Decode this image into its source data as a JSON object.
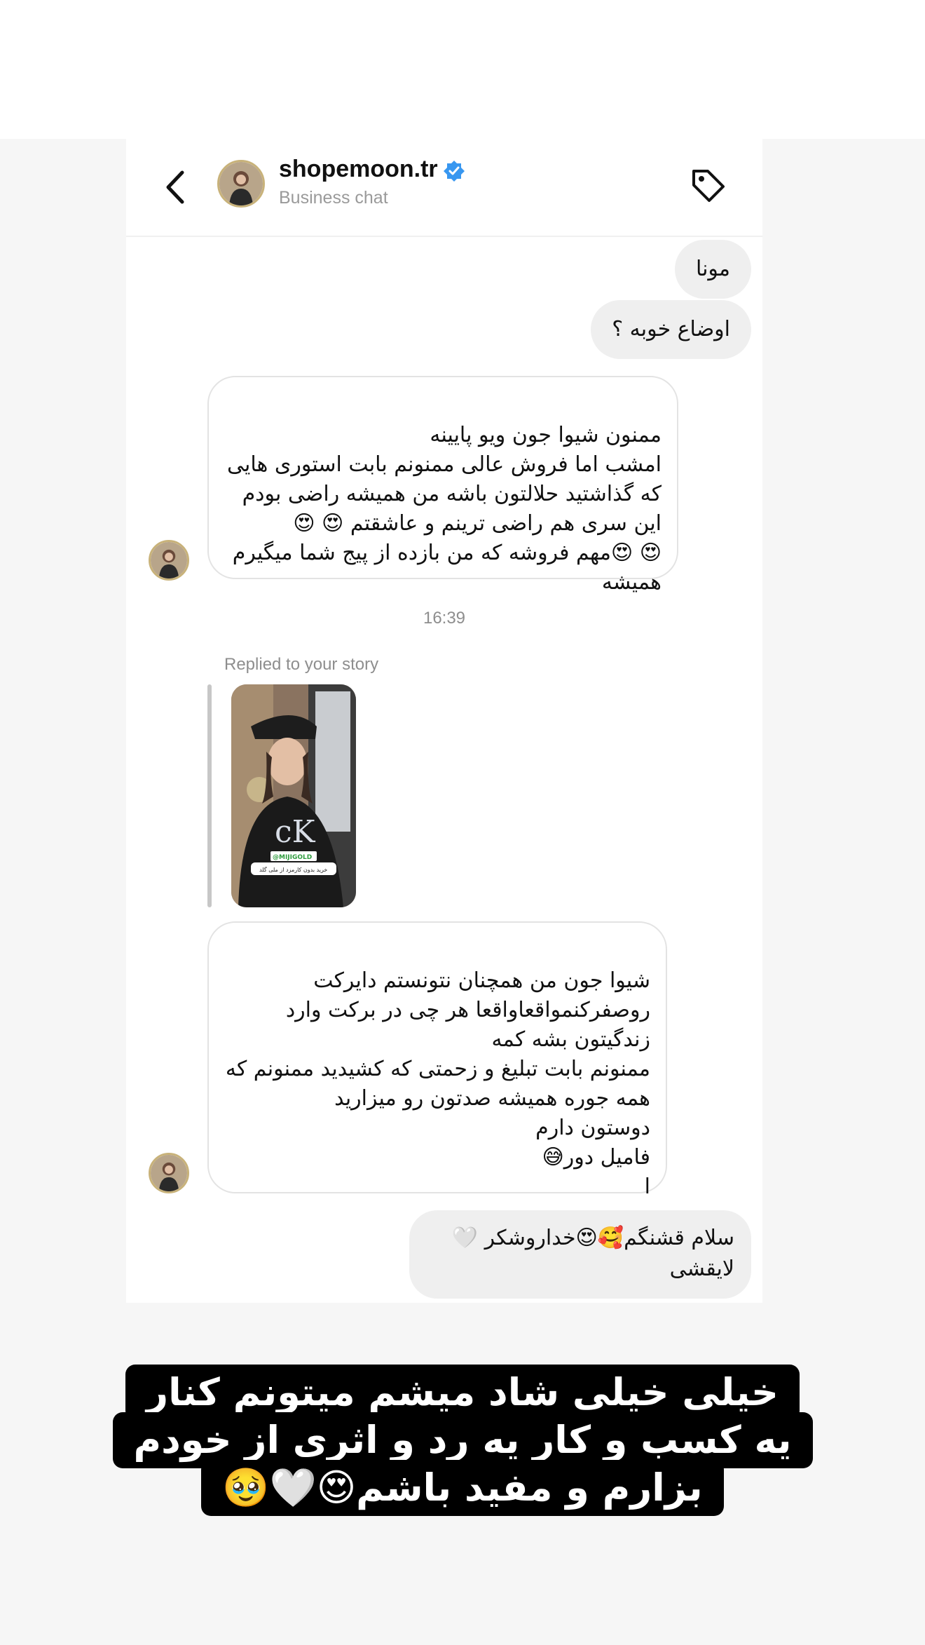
{
  "header": {
    "shop_name": "shopemoon.tr",
    "subtitle": "Business chat"
  },
  "messages": {
    "out_1": "مونا",
    "out_2": "اوضاع خوبه ؟",
    "in_1": "ممنون شیوا جون ویو پایینه\nامشب اما  فروش عالی ممنونم بابت استوری هایی که گذاشتید حلالتون باشه من همیشه راضی بودم این سری هم راضی ترینم و عاشقتم 😍 😍\n😍 😍مهم فروشه که من بازده از پیج شما میگیرم همیشه",
    "timestamp": "16:39",
    "replied_label": "Replied to your story",
    "in_2": "شیوا جون من همچنان نتونستم دایرکت روصفرکنمواقعاواقعا هر چی در برکت وارد زندگیتون بشه کمه\nممنونم بابت تبلیغ و زحمتی که کشیدید ممنونم که همه جوره همیشه صدتون رو میزارید\nدوستون دارم\nفامیل دور😅\nا",
    "out_3": "سلام قشنگم🥰😍خداروشکر 🤍 لایقشی"
  },
  "story": {
    "sticker_tag": "@MIJIGOLD",
    "sticker_text": "خرید بدون کارمزد از ملی گلد"
  },
  "caption": {
    "line_1": "خیلی خیلی شاد میشم میتونم کنار",
    "line_2": "یه کسب و کار یه رد و اثری از خودم",
    "line_3": "بزارم و مفید باشم😍🤍🥹"
  },
  "colors": {
    "verified": "#3897f0",
    "bubble_out": "#efefef",
    "caption_bg": "#000000"
  },
  "icons": [
    "back-arrow-icon",
    "verified-badge-icon",
    "tag-icon"
  ]
}
